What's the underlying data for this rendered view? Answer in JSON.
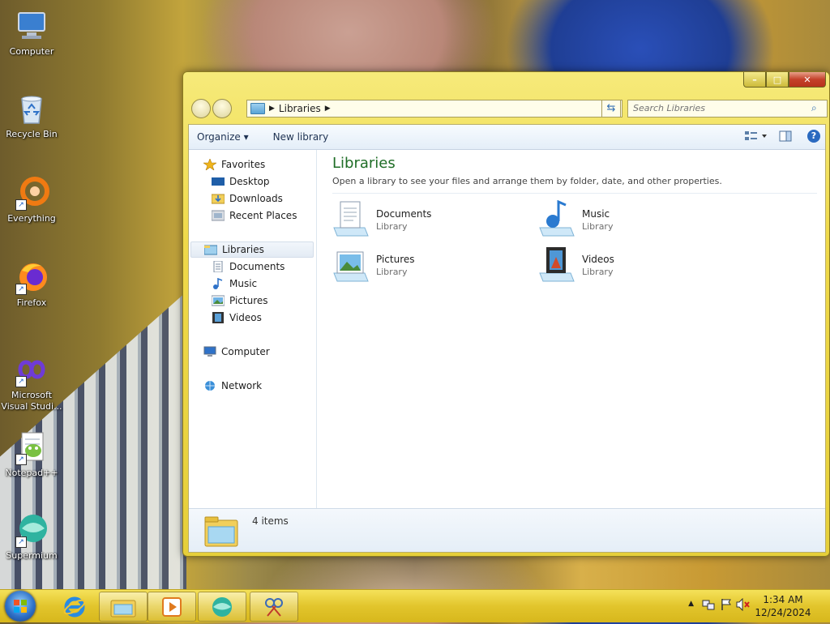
{
  "desktop": {
    "icons": [
      {
        "label": "Computer"
      },
      {
        "label": "Recycle Bin"
      },
      {
        "label": "Everything"
      },
      {
        "label": "Firefox"
      },
      {
        "label": "Microsoft Visual Studi..."
      },
      {
        "label": "Notepad++"
      },
      {
        "label": "Supermium"
      }
    ]
  },
  "window": {
    "caption": {
      "minimize": "–",
      "maximize": "□",
      "close": "✕"
    },
    "address": {
      "crumb": "Libraries"
    },
    "search": {
      "placeholder": "Search Libraries"
    },
    "toolbar": {
      "organize": "Organize ▾",
      "new_library": "New library"
    },
    "nav": {
      "favorites": {
        "label": "Favorites",
        "items": [
          "Desktop",
          "Downloads",
          "Recent Places"
        ]
      },
      "libraries": {
        "label": "Libraries",
        "items": [
          "Documents",
          "Music",
          "Pictures",
          "Videos"
        ]
      },
      "computer": "Computer",
      "network": "Network"
    },
    "main": {
      "title": "Libraries",
      "subtitle": "Open a library to see your files and arrange them by folder, date, and other properties.",
      "tiles": [
        {
          "name": "Documents",
          "type": "Library"
        },
        {
          "name": "Music",
          "type": "Library"
        },
        {
          "name": "Pictures",
          "type": "Library"
        },
        {
          "name": "Videos",
          "type": "Library"
        }
      ]
    },
    "details": {
      "count": "4 items"
    }
  },
  "taskbar": {
    "clock": {
      "time": "1:34 AM",
      "date": "12/24/2024"
    },
    "tray_arrow": "▲"
  }
}
